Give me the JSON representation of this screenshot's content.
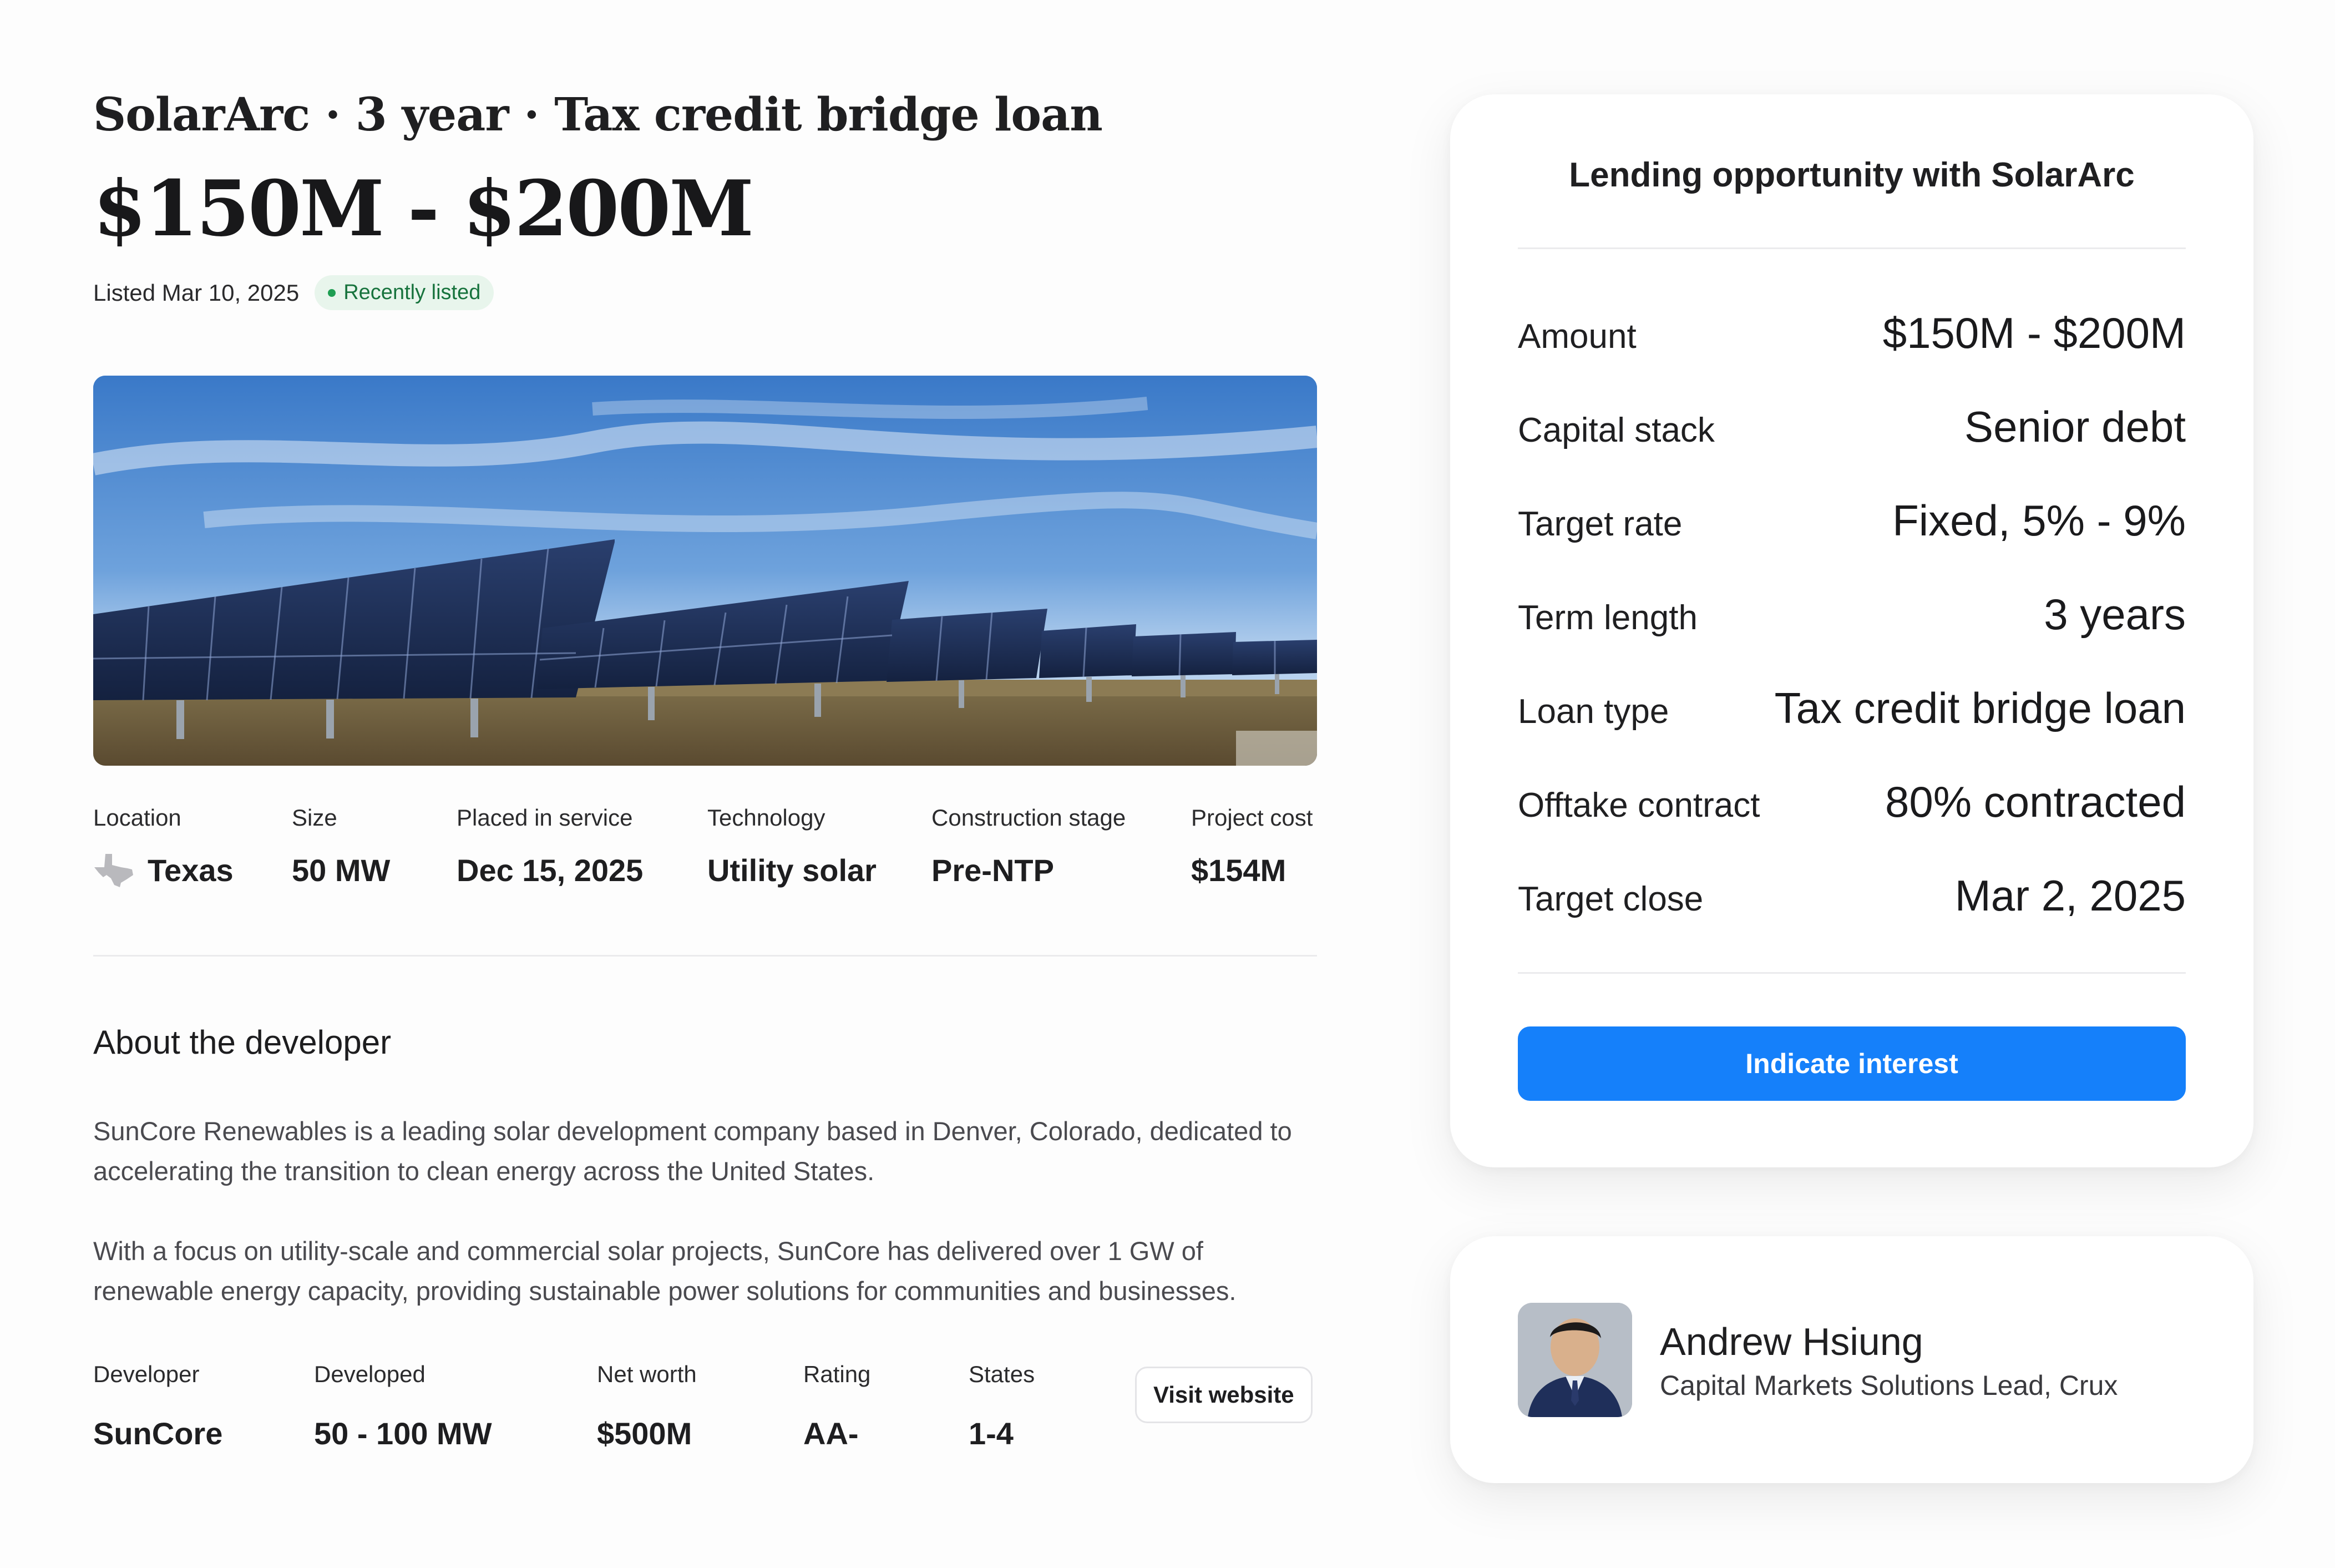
{
  "listing": {
    "headline": "SolarArc · 3 year · Tax credit bridge loan",
    "amount": "$150M - $200M",
    "listed_date": "Listed Mar 10, 2025",
    "badge": "Recently listed"
  },
  "project": {
    "facts": [
      {
        "label": "Location",
        "value": "Texas",
        "icon": "texas-state-icon"
      },
      {
        "label": "Size",
        "value": "50 MW"
      },
      {
        "label": "Placed in service",
        "value": "Dec 15, 2025"
      },
      {
        "label": "Technology",
        "value": "Utility solar"
      },
      {
        "label": "Construction stage",
        "value": "Pre-NTP"
      },
      {
        "label": "Project cost",
        "value": "$154M"
      }
    ]
  },
  "about": {
    "title": "About the developer",
    "paragraphs": [
      "SunCore Renewables is a leading solar development company based in Denver, Colorado, dedicated to accelerating the transition to clean energy across the United States.",
      "With a focus on utility-scale and commercial solar projects, SunCore has delivered over 1 GW of renewable energy capacity, providing sustainable power solutions for communities and businesses."
    ],
    "stats": [
      {
        "label": "Developer",
        "value": "SunCore"
      },
      {
        "label": "Developed",
        "value": "50 - 100 MW"
      },
      {
        "label": "Net worth",
        "value": "$500M"
      },
      {
        "label": "Rating",
        "value": "AA-"
      },
      {
        "label": "States",
        "value": "1-4"
      }
    ],
    "visit_label": "Visit website"
  },
  "opportunity": {
    "title": "Lending opportunity with SolarArc",
    "terms": [
      {
        "label": "Amount",
        "value": "$150M - $200M"
      },
      {
        "label": "Capital stack",
        "value": "Senior debt"
      },
      {
        "label": "Target rate",
        "value": "Fixed, 5% - 9%"
      },
      {
        "label": "Term length",
        "value": "3 years"
      },
      {
        "label": "Loan type",
        "value": "Tax credit bridge loan"
      },
      {
        "label": "Offtake contract",
        "value": "80% contracted"
      },
      {
        "label": "Target close",
        "value": "Mar 2, 2025"
      }
    ],
    "cta_label": "Indicate interest"
  },
  "contact": {
    "name": "Andrew Hsiung",
    "role": "Capital Markets Solutions Lead, Crux"
  },
  "colors": {
    "accent": "#1580fa",
    "badge_bg": "#e8f5ec",
    "badge_text": "#17733d"
  }
}
